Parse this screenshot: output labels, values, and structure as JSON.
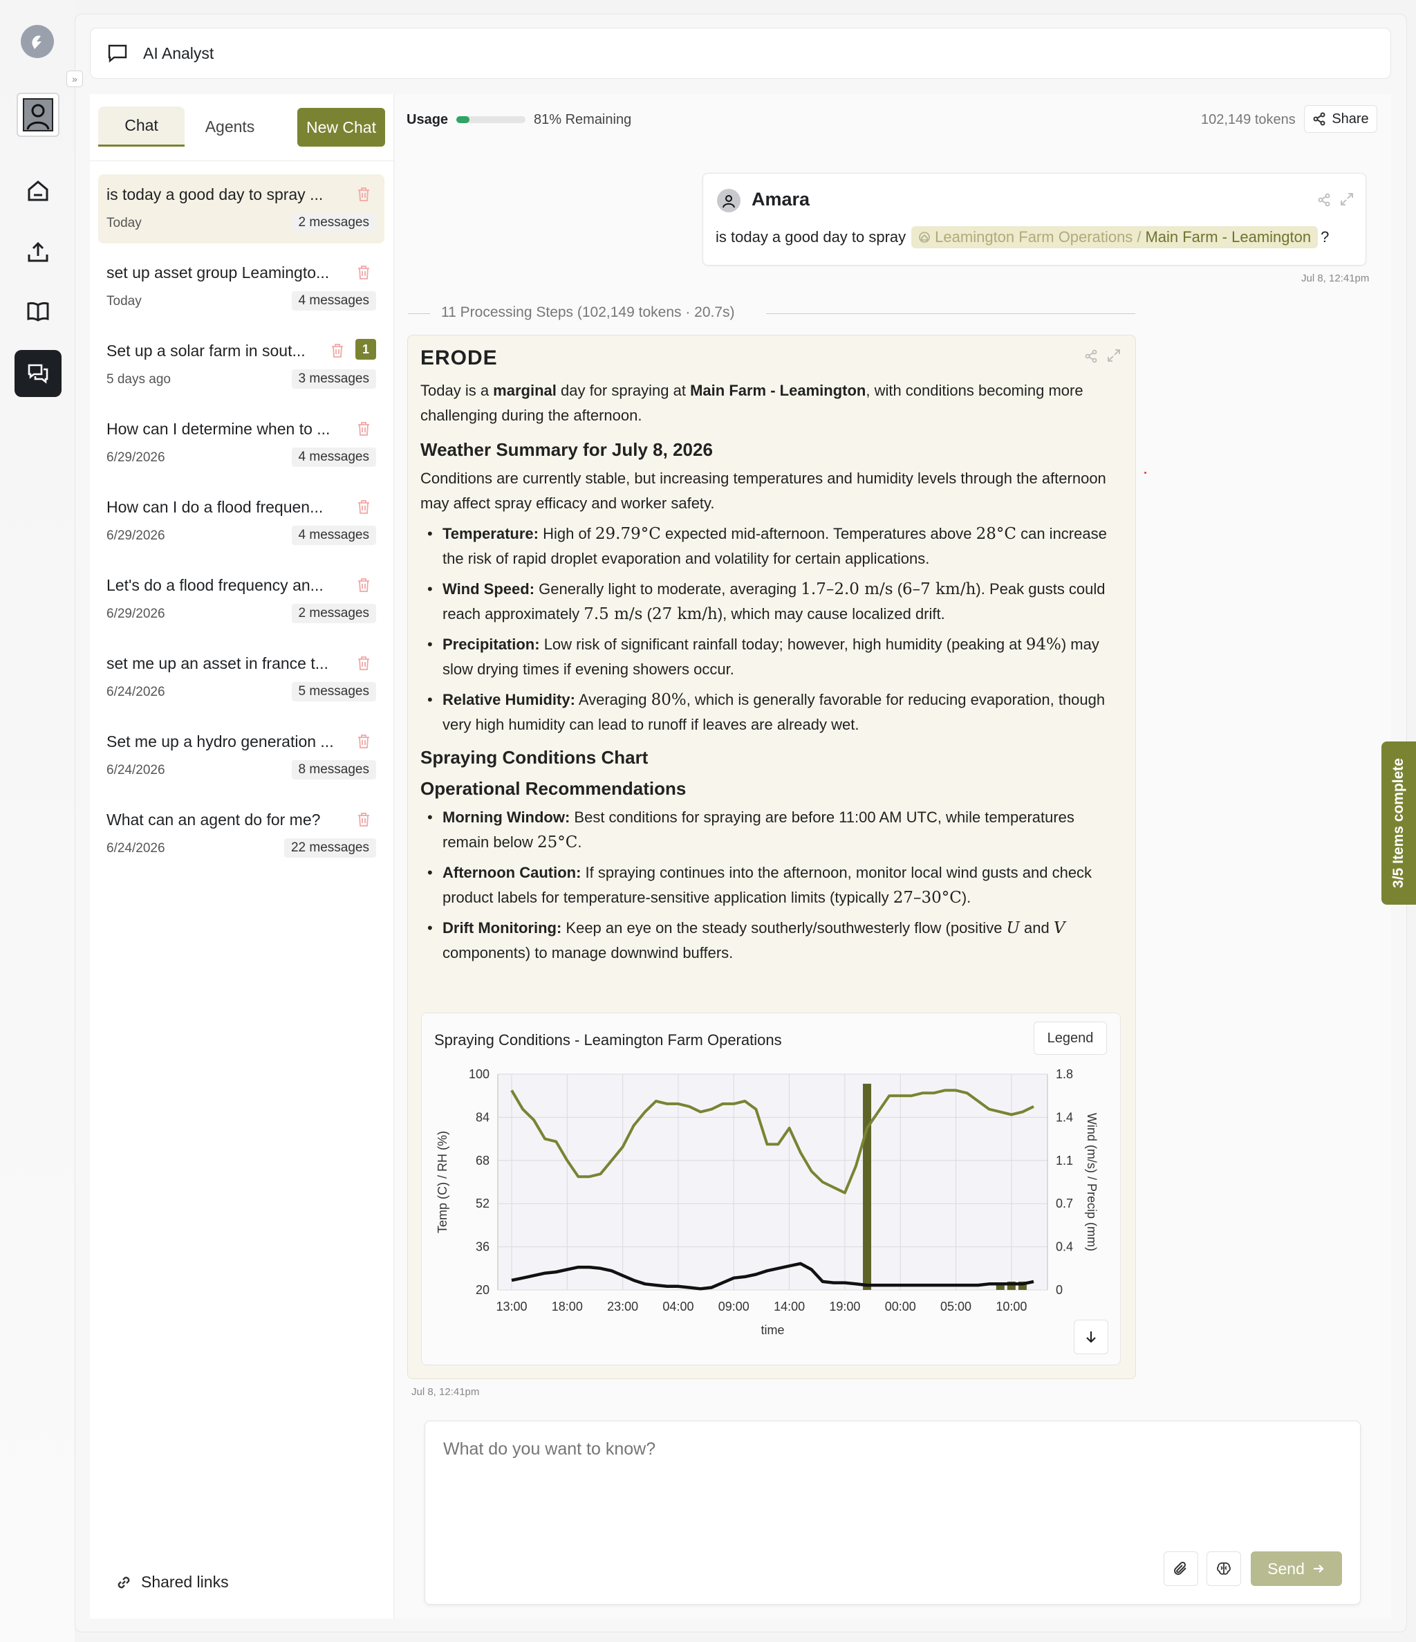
{
  "header": {
    "title": "AI Analyst"
  },
  "sidebar": {
    "tabs": {
      "chat": "Chat",
      "agents": "Agents"
    },
    "new_chat": "New Chat",
    "shared_links": "Shared links",
    "conversations": [
      {
        "title": "is today a good day to spray ...",
        "date": "Today",
        "count": "2 messages"
      },
      {
        "title": "set up asset group Leamingto...",
        "date": "Today",
        "count": "4 messages"
      },
      {
        "title": "Set up a solar farm in sout...",
        "date": "5 days ago",
        "count": "3 messages",
        "badge": "1"
      },
      {
        "title": "How can I determine when to ...",
        "date": "6/29/2026",
        "count": "4 messages"
      },
      {
        "title": "How can I do a flood frequen...",
        "date": "6/29/2026",
        "count": "4 messages"
      },
      {
        "title": "Let's do a flood frequency an...",
        "date": "6/29/2026",
        "count": "2 messages"
      },
      {
        "title": "set me up an asset in france t...",
        "date": "6/24/2026",
        "count": "5 messages"
      },
      {
        "title": "Set me up a hydro generation ...",
        "date": "6/24/2026",
        "count": "8 messages"
      },
      {
        "title": "What can an agent do for me?",
        "date": "6/24/2026",
        "count": "22 messages"
      }
    ]
  },
  "usage": {
    "label": "Usage",
    "remaining": "81% Remaining",
    "used_fraction": 0.19,
    "tokens": "102,149 tokens",
    "share": "Share"
  },
  "user_message": {
    "name": "Amara",
    "text": "is today a good day to spray",
    "chip_org": "Leamington Farm Operations",
    "chip_sep": "/",
    "chip_asset": "Main Farm - Leamington",
    "suffix": "?",
    "time": "Jul 8, 12:41pm"
  },
  "steps": "11 Processing Steps (102,149 tokens · 20.7s)",
  "response": {
    "brand": "ERODE",
    "intro_a": "Today is a ",
    "intro_b": "marginal",
    "intro_c": " day for spraying at ",
    "intro_d": "Main Farm - Leamington",
    "intro_e": ", with conditions becoming more challenging during the afternoon.",
    "h_weather": "Weather Summary for July 8, 2026",
    "weather_p": "Conditions are currently stable, but increasing temperatures and humidity levels through the afternoon may affect spray efficacy and worker safety.",
    "temp_label": "Temperature:",
    "temp_a": " High of ",
    "temp_m1": "29.79°C",
    "temp_b": " expected mid-afternoon. Temperatures above ",
    "temp_m2": "28°C",
    "temp_c": " can increase the risk of rapid droplet evaporation and volatility for certain applications.",
    "wind_label": "Wind Speed:",
    "wind_a": " Generally light to moderate, averaging ",
    "wind_m1": "1.7–2.0 m/s",
    "wind_b": " (",
    "wind_m2": "6–7 km/h",
    "wind_c": "). Peak gusts could reach approximately ",
    "wind_m3": "7.5 m/s",
    "wind_d": " (",
    "wind_m4": "27 km/h",
    "wind_e": "), which may cause localized drift.",
    "precip_label": "Precipitation:",
    "precip_a": " Low risk of significant rainfall today; however, high humidity (peaking at ",
    "precip_m": "94%",
    "precip_b": ") may slow drying times if evening showers occur.",
    "rh_label": "Relative Humidity:",
    "rh_a": " Averaging ",
    "rh_m": "80%",
    "rh_b": ", which is generally favorable for reducing evaporation, though very high humidity can lead to runoff if leaves are already wet.",
    "h_chart": "Spraying Conditions Chart",
    "h_ops": "Operational Recommendations",
    "morn_label": "Morning Window:",
    "morn_a": " Best conditions for spraying are before 11:00 AM UTC, while temperatures remain below ",
    "morn_m": "25°C",
    "morn_b": ".",
    "aft_label": "Afternoon Caution:",
    "aft_a": " If spraying continues into the afternoon, monitor local wind gusts and check product labels for temperature-sensitive application limits (typically ",
    "aft_m": "27–30°C",
    "aft_b": ").",
    "drift_label": "Drift Monitoring:",
    "drift_a": " Keep an eye on the steady southerly/southwesterly flow (positive ",
    "drift_u": "U",
    "drift_and": " and ",
    "drift_v": "V",
    "drift_b": " components) to manage downwind buffers.",
    "time": "Jul 8, 12:41pm"
  },
  "chart_data": {
    "type": "line",
    "title": "Spraying Conditions - Leamington Farm Operations",
    "legend_button": "Legend",
    "xlabel": "time",
    "ylabel_left": "Temp (C) / RH (%)",
    "ylabel_right": "Wind (m/s) / Precip (mm)",
    "x_ticks": [
      "13:00",
      "18:00",
      "23:00",
      "04:00",
      "09:00",
      "14:00",
      "19:00",
      "00:00",
      "05:00",
      "10:00"
    ],
    "y_left_ticks": [
      "100",
      "84",
      "68",
      "52",
      "36",
      "20"
    ],
    "y_right_ticks": [
      "1.8",
      "1.4",
      "1.1",
      "0.7",
      "0.4",
      "0"
    ],
    "ylim_left": [
      20,
      100
    ],
    "ylim_right": [
      0,
      1.8
    ],
    "x_hours": [
      0,
      1,
      2,
      3,
      4,
      5,
      6,
      7,
      8,
      9,
      10,
      11,
      12,
      13,
      14,
      15,
      16,
      17,
      18,
      19,
      20,
      21,
      22,
      23,
      24,
      25,
      26,
      27,
      28,
      29,
      30,
      31,
      32,
      33,
      34,
      35,
      36,
      37,
      38,
      39,
      40,
      41,
      42,
      43,
      44,
      45,
      46,
      47
    ],
    "series": [
      {
        "axis": "left",
        "color": "#7a8332",
        "values": [
          94,
          87,
          83,
          76,
          75,
          68,
          62,
          62,
          63,
          68,
          73,
          81,
          86,
          90,
          89,
          89,
          88,
          86,
          87,
          89,
          89,
          90,
          87,
          74,
          74,
          80,
          71,
          64,
          60,
          58,
          56,
          66,
          80,
          86,
          92,
          92,
          92,
          93,
          93,
          94,
          94,
          93,
          90,
          87,
          86,
          85,
          86,
          88
        ]
      },
      {
        "axis": "right",
        "color": "#111111",
        "values": [
          0.08,
          0.1,
          0.12,
          0.14,
          0.15,
          0.17,
          0.19,
          0.19,
          0.18,
          0.16,
          0.12,
          0.08,
          0.05,
          0.04,
          0.03,
          0.03,
          0.02,
          0.01,
          0.02,
          0.06,
          0.1,
          0.11,
          0.13,
          0.16,
          0.18,
          0.2,
          0.22,
          0.17,
          0.07,
          0.06,
          0.06,
          0.05,
          0.04,
          0.04,
          0.04,
          0.04,
          0.04,
          0.04,
          0.04,
          0.04,
          0.04,
          0.04,
          0.04,
          0.05,
          0.05,
          0.05,
          0.05,
          0.07
        ]
      },
      {
        "axis": "right",
        "type": "bar",
        "color": "#5e6428",
        "values": [
          0,
          0,
          0,
          0,
          0,
          0,
          0,
          0,
          0,
          0,
          0,
          0,
          0,
          0,
          0,
          0,
          0,
          0,
          0,
          0,
          0,
          0,
          0,
          0,
          0,
          0,
          0,
          0,
          0,
          0,
          0,
          0,
          1.72,
          0,
          0,
          0,
          0,
          0,
          0,
          0,
          0,
          0,
          0,
          0,
          0.06,
          0.07,
          0.07,
          0
        ]
      }
    ]
  },
  "input": {
    "placeholder": "What do you want to know?",
    "send": "Send"
  },
  "tasks": {
    "label": "3/5 Items complete"
  }
}
